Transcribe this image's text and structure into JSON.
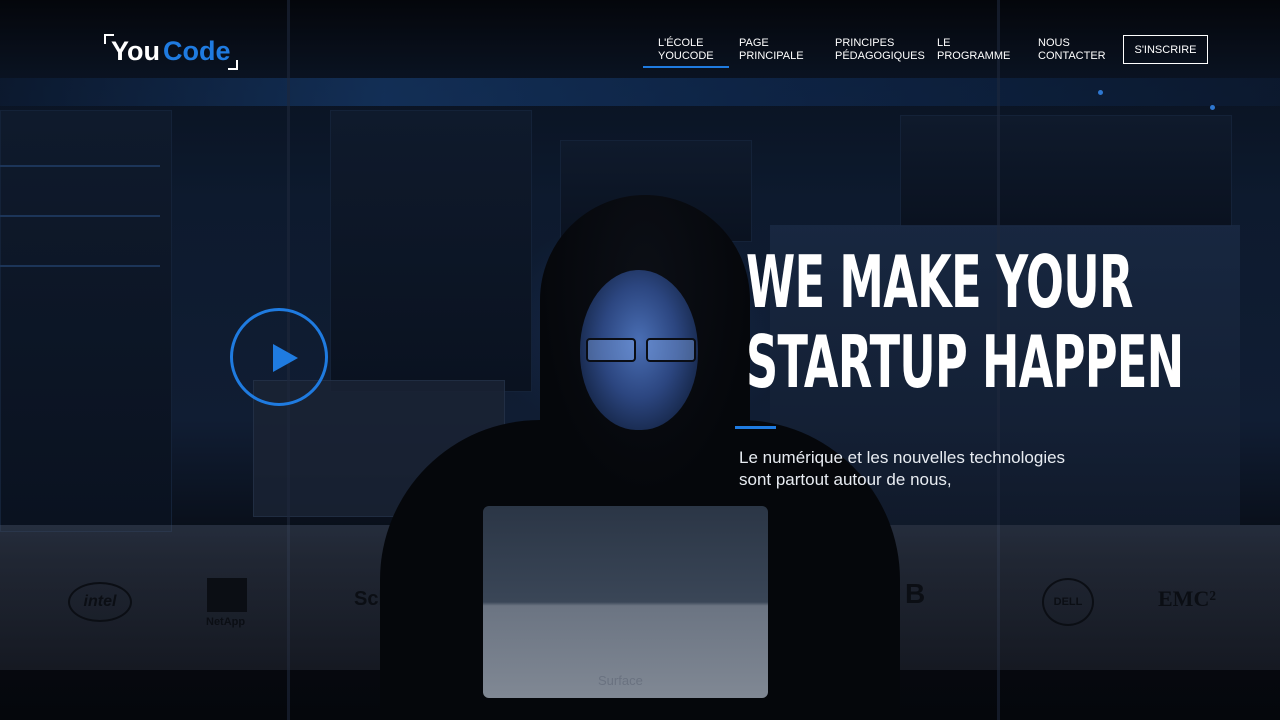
{
  "brand": {
    "logo_part1": "You",
    "logo_part2": "Code",
    "accent_color": "#1f7be0"
  },
  "nav": {
    "items": [
      {
        "line1": "L'ÉCOLE",
        "line2": "YOUCODE",
        "active": true
      },
      {
        "line1": "PAGE",
        "line2": "PRINCIPALE",
        "active": false
      },
      {
        "line1": "PRINCIPES",
        "line2": "PÉDAGOGIQUES",
        "active": false
      },
      {
        "line1": "LE",
        "line2": "PROGRAMME",
        "active": false
      },
      {
        "line1": "NOUS",
        "line2": "CONTACTER",
        "active": false
      }
    ],
    "signup_label": "S'INSCRIRE"
  },
  "hero": {
    "headline_line1": "WE MAKE YOUR",
    "headline_line2": "STARTUP HAPPEN",
    "subtext_line1": "Le numérique et les nouvelles technologies",
    "subtext_line2": "sont partout autour de nous,",
    "play_icon": "play-icon"
  },
  "partners": {
    "intel": "intel",
    "netapp": "NetApp",
    "schneider": "Sch",
    "brocade": "B",
    "dell": "DELL",
    "emc": "EMC²"
  },
  "device_label": "Surface"
}
